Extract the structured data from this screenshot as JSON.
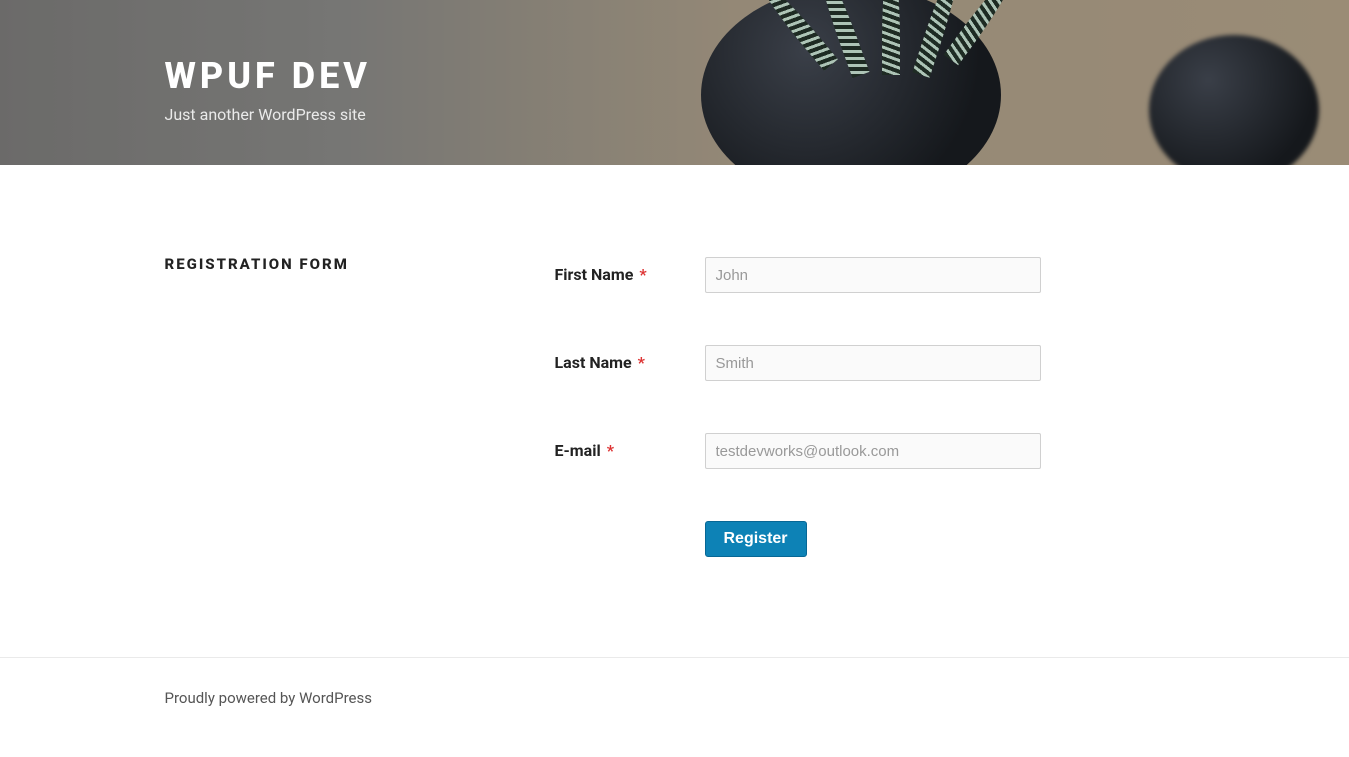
{
  "header": {
    "site_title": "WPUF DEV",
    "tagline": "Just another WordPress site"
  },
  "main": {
    "heading": "REGISTRATION FORM"
  },
  "form": {
    "fields": [
      {
        "label": "First Name",
        "required_mark": "*",
        "value": "",
        "placeholder": "John"
      },
      {
        "label": "Last Name",
        "required_mark": "*",
        "value": "",
        "placeholder": "Smith"
      },
      {
        "label": "E-mail",
        "required_mark": "*",
        "value": "",
        "placeholder": "testdevworks@outlook.com"
      }
    ],
    "submit_label": "Register"
  },
  "footer": {
    "powered_by": "Proudly powered by WordPress"
  }
}
